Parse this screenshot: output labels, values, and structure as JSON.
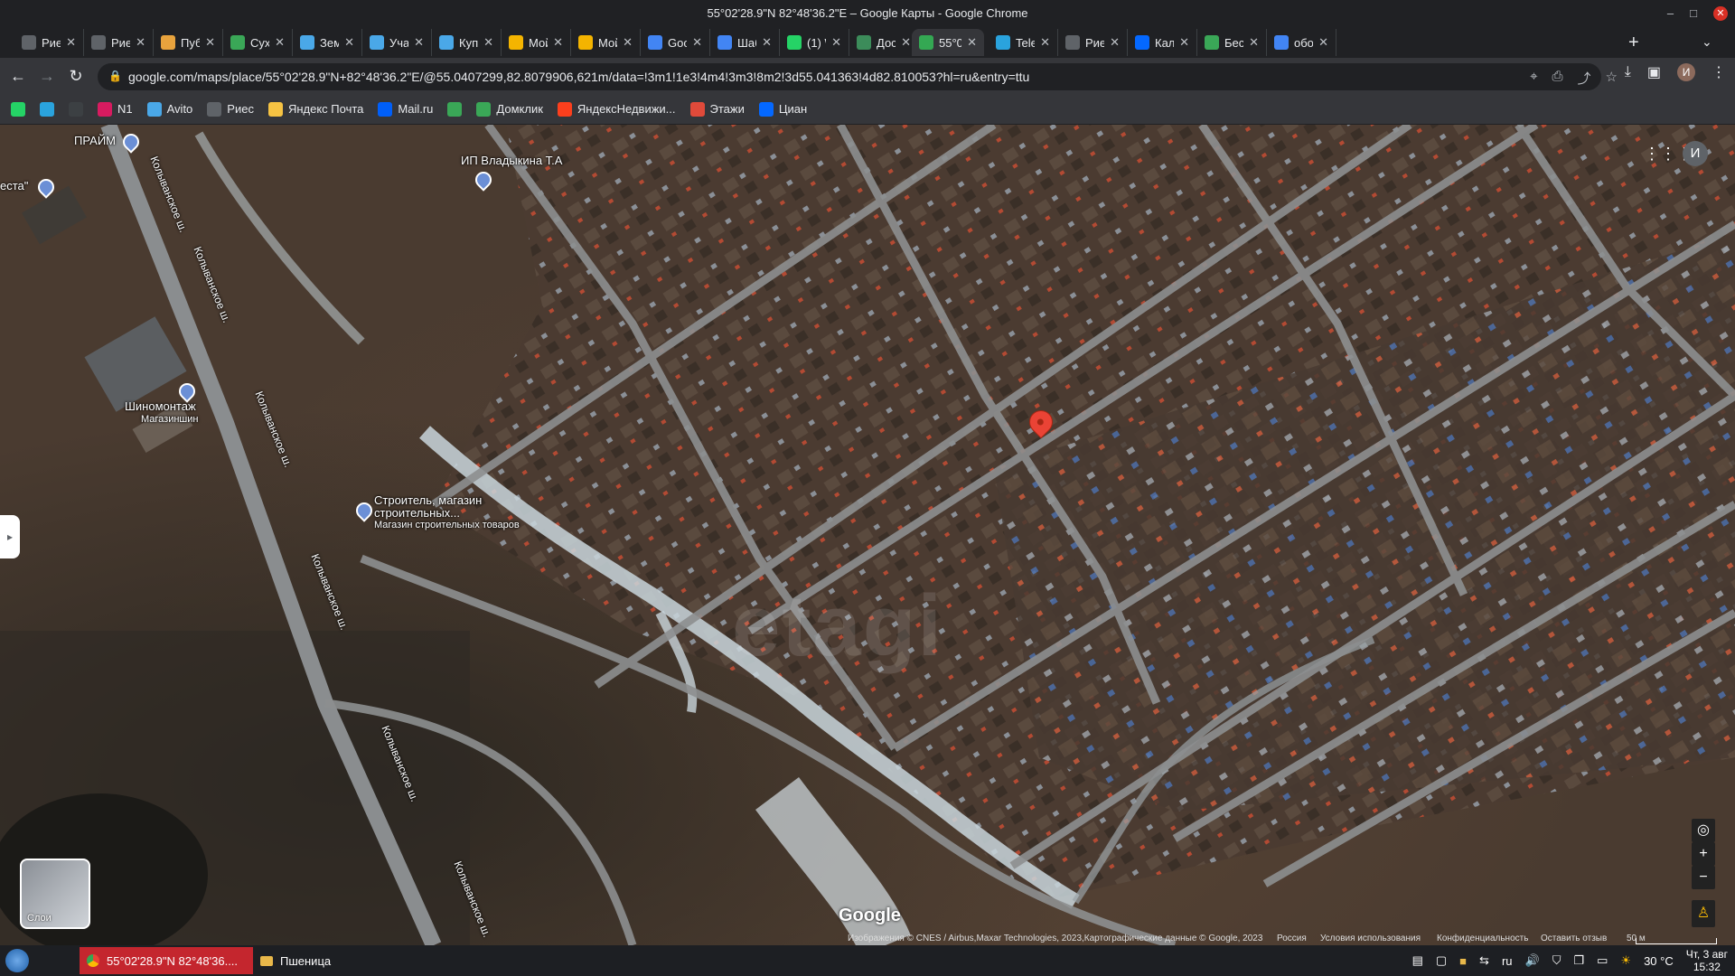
{
  "window": {
    "title": "55°02'28.9\"N 82°48'36.2\"E – Google Карты - Google Chrome",
    "min": "–",
    "max": "□",
    "close": "✕"
  },
  "tabs": [
    {
      "label": "Риес",
      "icon": "riesfav"
    },
    {
      "label": "Риес",
      "icon": "riesfav"
    },
    {
      "label": "Публ",
      "icon": "ruler-icon"
    },
    {
      "label": "Суха",
      "icon": "domclick-icon"
    },
    {
      "label": "Земе",
      "icon": "avito-icon"
    },
    {
      "label": "Учас",
      "icon": "avito-icon"
    },
    {
      "label": "Купи",
      "icon": "avito-icon"
    },
    {
      "label": "Мой",
      "icon": "drive-icon"
    },
    {
      "label": "Мой",
      "icon": "drive-icon"
    },
    {
      "label": "Goog",
      "icon": "google-icon"
    },
    {
      "label": "Шаб",
      "icon": "docs-icon"
    },
    {
      "label": "(1) W",
      "icon": "whatsapp-icon"
    },
    {
      "label": "Дост",
      "icon": "green-icon"
    },
    {
      "label": "55°0",
      "icon": "maps-icon"
    },
    {
      "label": "Teleg",
      "icon": "telegram-icon"
    },
    {
      "label": "Риес",
      "icon": "riesfav"
    },
    {
      "label": "Каль",
      "icon": "cian-icon"
    },
    {
      "label": "Бесп",
      "icon": "domclick-icon"
    },
    {
      "label": "обоз",
      "icon": "google-icon"
    }
  ],
  "active_tab_index": 13,
  "toolbar": {
    "url": "google.com/maps/place/55°02'28.9\"N+82°48'36.2\"E/@55.0407299,82.8079906,621m/data=!3m1!1e3!4m4!3m3!8m2!3d55.041363!4d82.810053?hl=ru&entry=ttu",
    "profile_initial": "И"
  },
  "bookmarks": [
    {
      "label": "",
      "icon": "whatsapp-icon"
    },
    {
      "label": "",
      "icon": "telegram-icon"
    },
    {
      "label": "",
      "icon": "plus-icon"
    },
    {
      "label": "N1",
      "icon": "n1-icon"
    },
    {
      "label": "Avito",
      "icon": "avito-icon"
    },
    {
      "label": "Риес",
      "icon": "riesfav"
    },
    {
      "label": "Яндекс Почта",
      "icon": "mail-icon"
    },
    {
      "label": "Mail.ru",
      "icon": "at-icon"
    },
    {
      "label": "",
      "icon": "domclick-icon"
    },
    {
      "label": "Домклик",
      "icon": "domclick-icon"
    },
    {
      "label": "ЯндексНедвижи...",
      "icon": "house-icon"
    },
    {
      "label": "Этажи",
      "icon": "etagi-icon"
    },
    {
      "label": "Циан",
      "icon": "cian-icon"
    }
  ],
  "map": {
    "labels": {
      "praim": "ПРАЙМ",
      "vesta": "еста\"",
      "ip": "ИП Владыкина Т.А",
      "shino": "Шиномонтаж",
      "shino_sub": "Магазиншин",
      "stroitel": "Строитель, магазин",
      "stroitel2": "строительных...",
      "stroitel_sub": "Магазин строительных товаров"
    },
    "road_name": "Колыванское ш.",
    "watermark": "etagi",
    "layers_label": "Слои",
    "avatar_initial": "И",
    "zoom_in": "+",
    "zoom_out": "−",
    "google_logo": "Google",
    "attribution": {
      "imagery": "Изображения © CNES / Airbus,Maxar Technologies, 2023,Картографические данные © Google, 2023",
      "country": "Россия",
      "terms": "Условия использования",
      "privacy": "Конфиденциальность",
      "feedback": "Оставить отзыв",
      "scale": "50 м"
    }
  },
  "taskbar": {
    "items": [
      {
        "label": "55°02'28.9\"N 82°48'36....",
        "icon": "chrome-icon",
        "active": true
      },
      {
        "label": "Пшеница",
        "icon": "folder-icon",
        "active": false
      }
    ],
    "lang": "ru",
    "weather": "30 °C",
    "date": "Чт, 3 авг",
    "time": "15:32"
  },
  "colors": {
    "active_task": "#c4262e",
    "pin": "#ea4335",
    "poi": "#6b8fd6"
  }
}
